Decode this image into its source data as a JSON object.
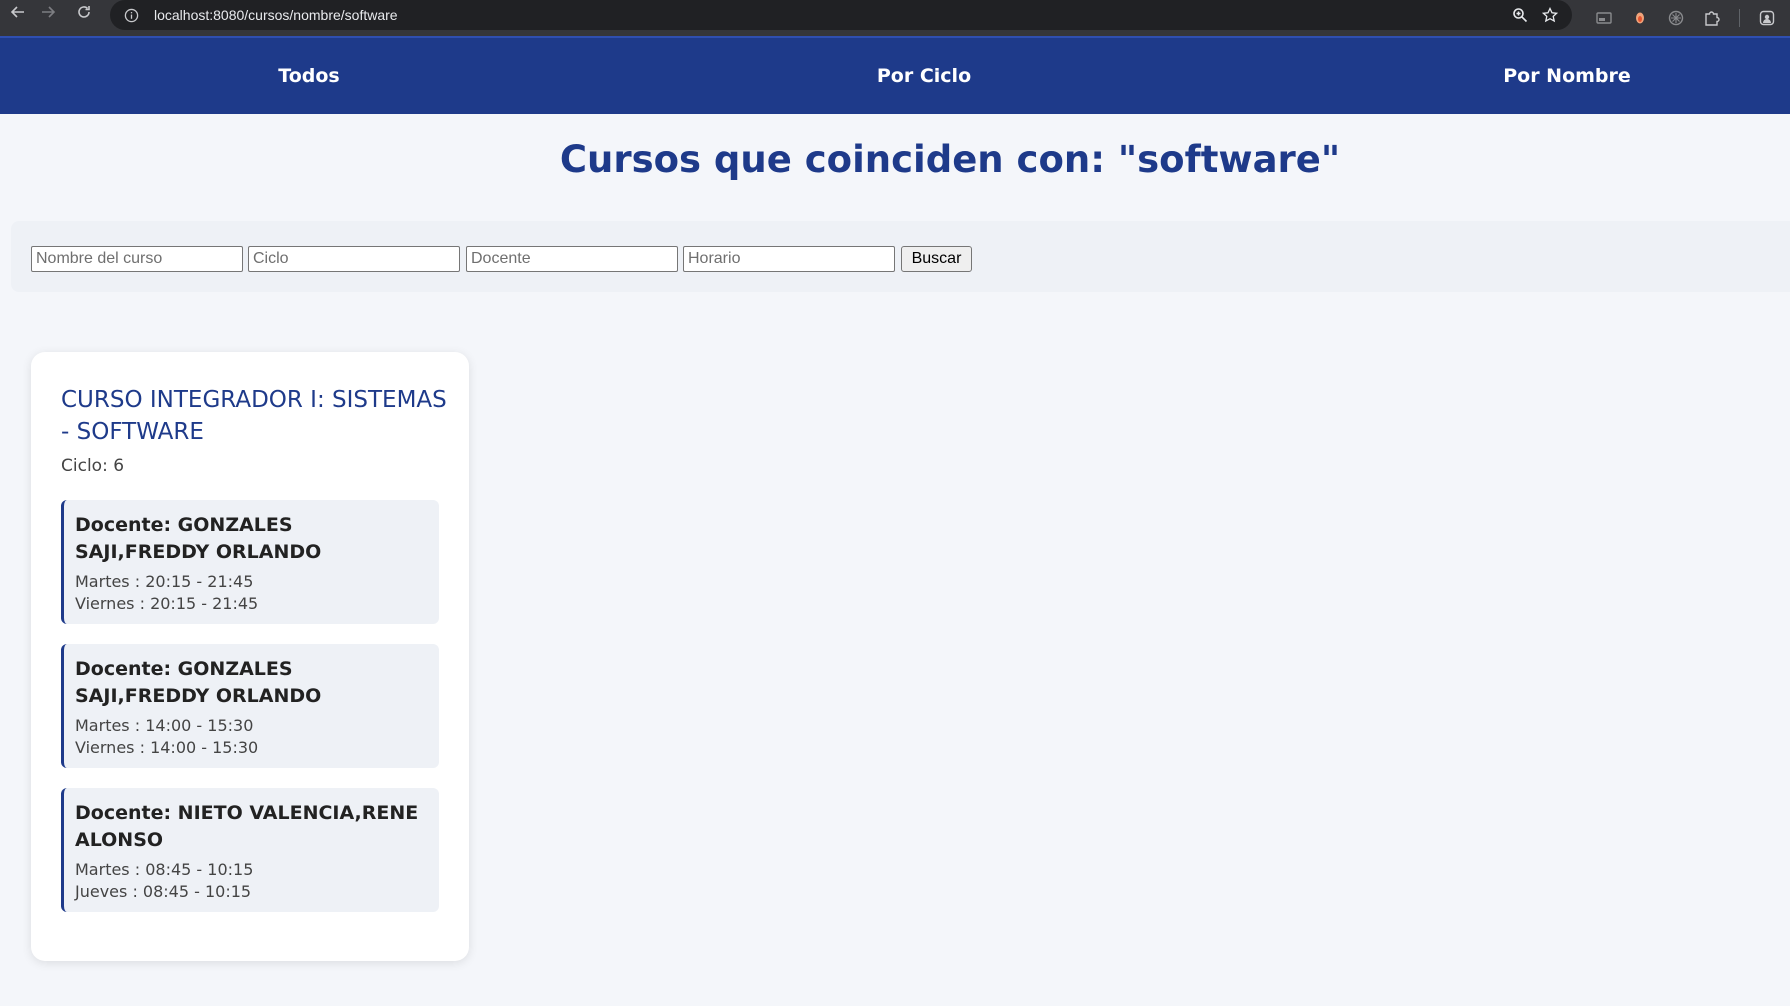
{
  "browser": {
    "url": "localhost:8080/cursos/nombre/software"
  },
  "nav": {
    "items": [
      {
        "label": "Todos"
      },
      {
        "label": "Por Ciclo"
      },
      {
        "label": "Por Nombre"
      }
    ]
  },
  "page": {
    "title": "Cursos que coinciden con: \"software\""
  },
  "search": {
    "nombre_placeholder": "Nombre del curso",
    "ciclo_placeholder": "Ciclo",
    "docente_placeholder": "Docente",
    "horario_placeholder": "Horario",
    "button_label": "Buscar"
  },
  "course": {
    "title": "CURSO INTEGRADOR I: SISTEMAS - SOFTWARE",
    "ciclo": "Ciclo: 6",
    "schedules": [
      {
        "docente": "Docente: GONZALES SAJI,FREDDY ORLANDO",
        "lines": [
          "Martes : 20:15 - 21:45",
          "Viernes : 20:15 - 21:45"
        ]
      },
      {
        "docente": "Docente: GONZALES SAJI,FREDDY ORLANDO",
        "lines": [
          "Martes : 14:00 - 15:30",
          "Viernes : 14:00 - 15:30"
        ]
      },
      {
        "docente": "Docente: NIETO VALENCIA,RENE ALONSO",
        "lines": [
          "Martes : 08:45 - 10:15",
          "Jueves : 08:45 - 10:15"
        ]
      }
    ]
  },
  "colors": {
    "brand": "#1e3a8a",
    "page_bg": "#f4f6fa",
    "panel_bg": "#eef1f6"
  }
}
